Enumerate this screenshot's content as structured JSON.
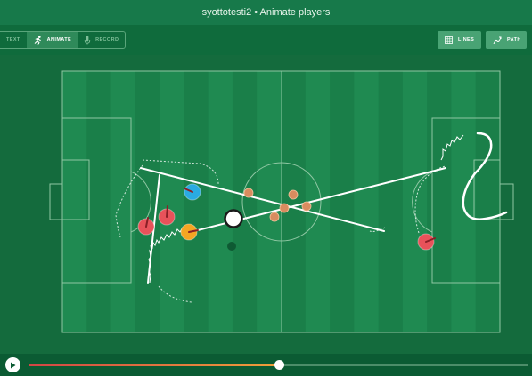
{
  "window": {
    "title": "syottotesti2 • Animate players"
  },
  "toolbar": {
    "modes": [
      {
        "label": "TEXT",
        "icon": "text-icon",
        "active": false
      },
      {
        "label": "ANIMATE",
        "icon": "running-player-icon",
        "active": true
      },
      {
        "label": "RECORD",
        "icon": "microphone-icon",
        "active": false
      }
    ],
    "lines_label": "LINES",
    "path_label": "PATH"
  },
  "pitch": {
    "colors": {
      "light_stripe": "#1f8a51",
      "dark_stripe": "#1a7f49",
      "line": "#8fc7a3"
    },
    "ball": {
      "color": "#ffffff"
    },
    "players": [
      {
        "team": "red",
        "color": "#e8525a"
      },
      {
        "team": "red",
        "color": "#e8525a"
      },
      {
        "team": "red",
        "color": "#e8525a"
      },
      {
        "team": "blue",
        "color": "#29abe2"
      },
      {
        "team": "yellow",
        "color": "#f5a623"
      },
      {
        "team": "orange",
        "color": "#d98c5f"
      }
    ]
  },
  "timeline": {
    "progress": 0.503,
    "fill_start_color": "#d24545",
    "fill_end_color": "#f0a03a"
  }
}
